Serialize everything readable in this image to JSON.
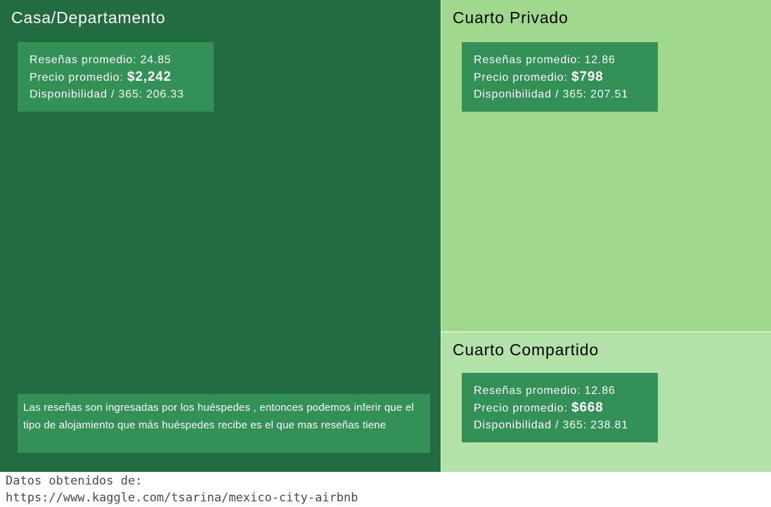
{
  "chart_data": {
    "type": "treemap",
    "categories": [
      "Casa/Departamento",
      "Cuarto Privado",
      "Cuarto Compartido"
    ],
    "tiles": [
      {
        "name": "Casa/Departamento",
        "resenas_label": "Reseñas promedio:",
        "resenas": "24.85",
        "precio_label": "Precio promedio:",
        "precio": "$2,242",
        "disponibilidad_label": "Disponibilidad / 365:",
        "disponibilidad": "206.33",
        "fill": "#236b41",
        "text_color": "#ffffff"
      },
      {
        "name": "Cuarto Privado",
        "resenas_label": "Reseñas promedio:",
        "resenas": "12.86",
        "precio_label": "Precio promedio:",
        "precio": "$798",
        "disponibilidad_label": "Disponibilidad / 365:",
        "disponibilidad": "207.51",
        "fill": "#a0d98e",
        "text_color": "#000000"
      },
      {
        "name": "Cuarto Compartido",
        "resenas_label": "Reseñas promedio:",
        "resenas": "12.86",
        "precio_label": "Precio promedio:",
        "precio": "$668",
        "disponibilidad_label": "Disponibilidad / 365:",
        "disponibilidad": "238.81",
        "fill": "#b3e2a8",
        "text_color": "#000000"
      }
    ],
    "annotation": "Las reseñas son ingresadas por los huéspedes , entonces podemos inferir que el tipo de alojamiento que más huéspedes recibe es el que mas reseñas tiene",
    "box_color": "#339057"
  },
  "footer": {
    "line1": "Datos obtenidos de:",
    "line2": "https://www.kaggle.com/tsarina/mexico-city-airbnb"
  }
}
